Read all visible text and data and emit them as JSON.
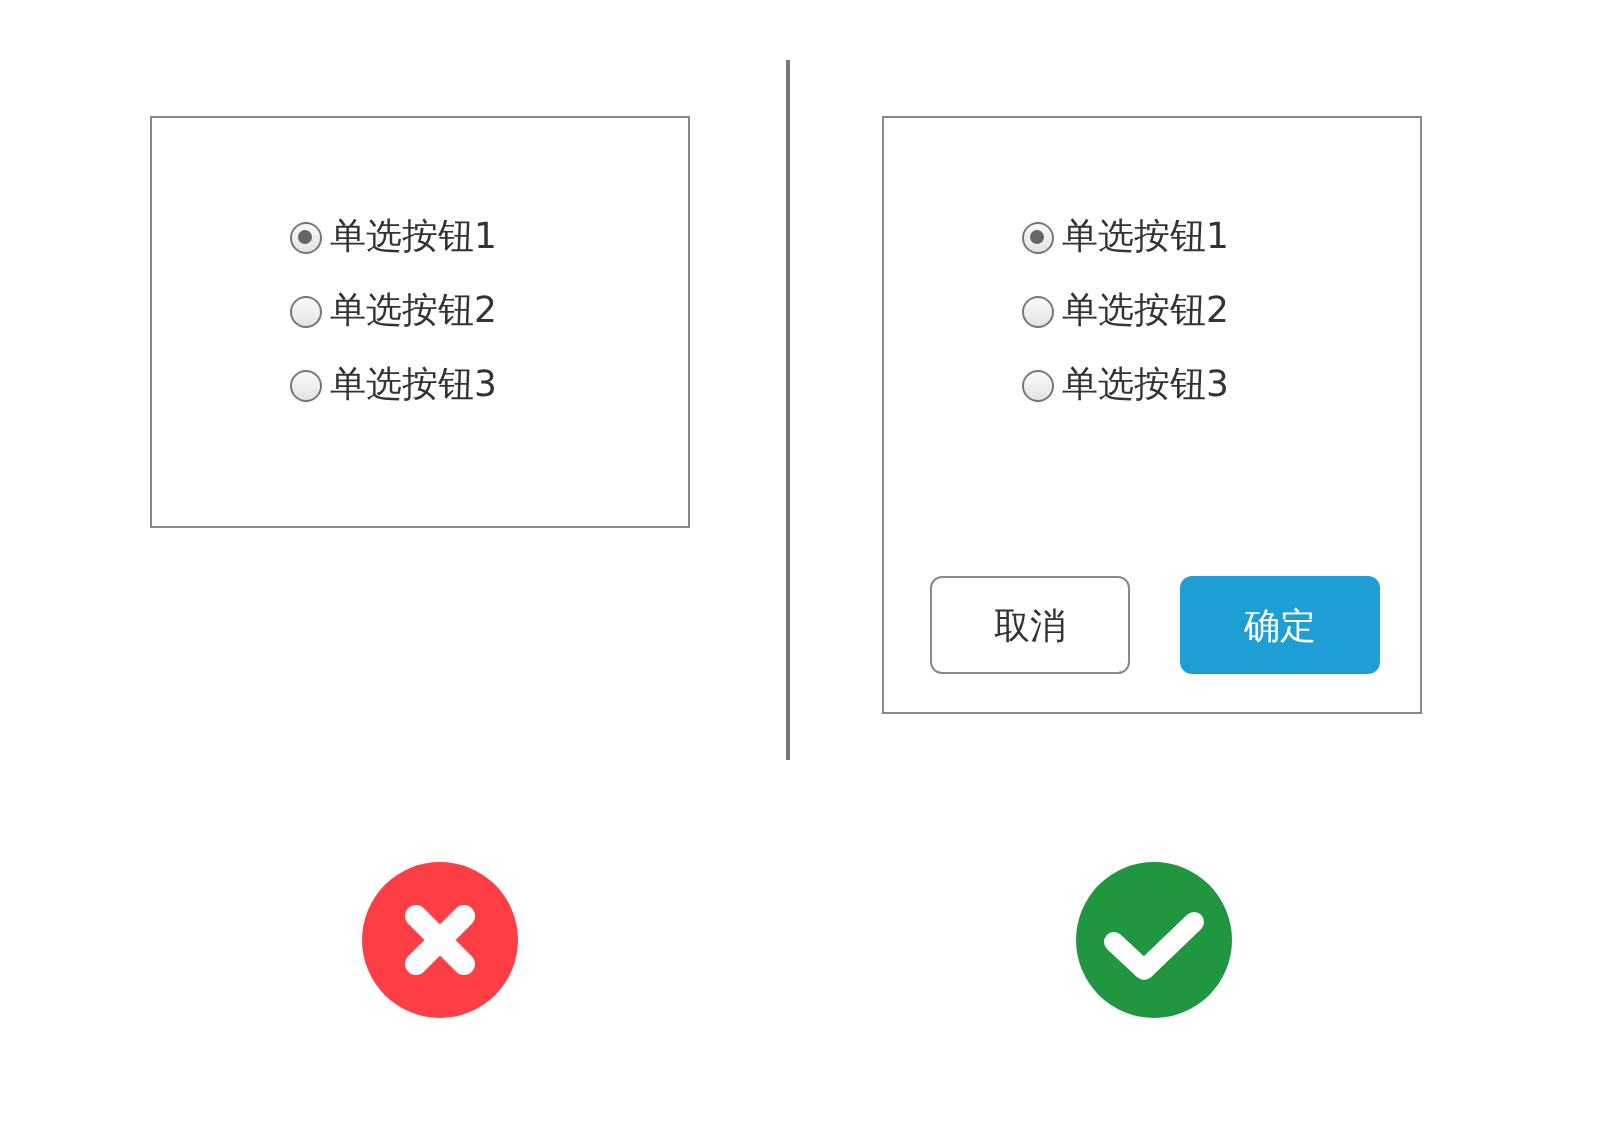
{
  "panels": [
    {
      "kind": "plain",
      "verdict": {
        "kind": "wrong"
      },
      "options": [
        {
          "label": "单选按钮1",
          "selected": true
        },
        {
          "label": "单选按钮2",
          "selected": false
        },
        {
          "label": "单选按钮3",
          "selected": false
        }
      ]
    },
    {
      "kind": "dialog",
      "verdict": {
        "kind": "right"
      },
      "options": [
        {
          "label": "单选按钮1",
          "selected": true
        },
        {
          "label": "单选按钮2",
          "selected": false
        },
        {
          "label": "单选按钮3",
          "selected": false
        }
      ],
      "buttons": [
        {
          "label": "取消",
          "kind": "secondary"
        },
        {
          "label": "确定",
          "kind": "primary"
        }
      ]
    }
  ]
}
